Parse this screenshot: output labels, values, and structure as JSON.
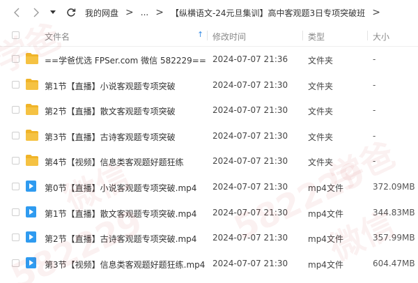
{
  "nav": {
    "back_icon": "chevron-left-icon",
    "forward_icon": "chevron-right-icon",
    "history_icon": "caret-down-icon",
    "refresh_icon": "refresh-icon"
  },
  "breadcrumb": {
    "root": "我的网盘",
    "ellipsis": "...",
    "parent": "【纵横语文-24元旦集训】高中客观题3日专项突破班",
    "separator": ">"
  },
  "columns": {
    "name": "文件名",
    "modified": "修改时间",
    "type": "类型",
    "size": "大小",
    "sort_indicator": "↑"
  },
  "files": [
    {
      "name": "==学爸优选 FPSer.com 微信 582229==",
      "modified": "2024-07-07 21:36",
      "type": "文件夹",
      "size": "-",
      "icon": "folder-icon"
    },
    {
      "name": "第1节【直播】小说客观题专项突破",
      "modified": "2024-07-07 21:30",
      "type": "文件夹",
      "size": "-",
      "icon": "folder-icon"
    },
    {
      "name": "第2节【直播】散文客观题专项突破",
      "modified": "2024-07-07 21:30",
      "type": "文件夹",
      "size": "-",
      "icon": "folder-icon"
    },
    {
      "name": "第3节【直播】古诗客观题专项突破",
      "modified": "2024-07-07 21:30",
      "type": "文件夹",
      "size": "-",
      "icon": "folder-icon"
    },
    {
      "name": "第4节【视频】信息类客观题好题狂练",
      "modified": "2024-07-07 21:30",
      "type": "文件夹",
      "size": "-",
      "icon": "folder-icon"
    },
    {
      "name": "第0节【直播】小说客观题专项突破.mp4",
      "modified": "2024-07-07 21:30",
      "type": "mp4文件",
      "size": "372.09MB",
      "icon": "video-file-icon"
    },
    {
      "name": "第1节【直播】散文客观题专项突破.mp4",
      "modified": "2024-07-07 21:30",
      "type": "mp4文件",
      "size": "344.83MB",
      "icon": "video-file-icon"
    },
    {
      "name": "第2节【直播】古诗客观题专项突破.mp4",
      "modified": "2024-07-07 21:30",
      "type": "mp4文件",
      "size": "357.99MB",
      "icon": "video-file-icon"
    },
    {
      "name": "第3节【视频】信息类客观题好题狂练.mp4",
      "modified": "2024-07-07 21:30",
      "type": "mp4文件",
      "size": "604.47MB",
      "icon": "video-file-icon"
    }
  ],
  "watermarks": [
    "学爸",
    "微信",
    "582229",
    "学爸",
    "微信",
    "582229"
  ],
  "colors": {
    "folder": "#f5c243",
    "folder_tab": "#f0b429",
    "video": "#2f9bf0",
    "sort_arrow": "#3a8ee6",
    "watermark": "#c83c3c"
  }
}
